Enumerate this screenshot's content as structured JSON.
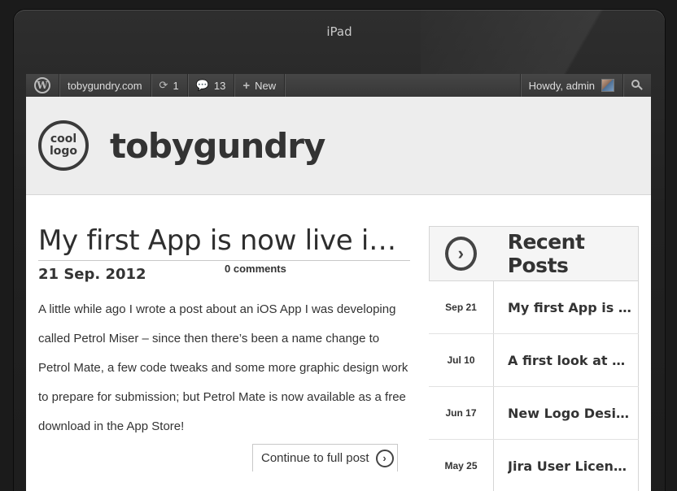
{
  "device": {
    "title": "iPad"
  },
  "adminbar": {
    "wp_logo": "W",
    "site_name": "tobygundry.com",
    "updates_icon": "refresh-icon",
    "updates_count": "1",
    "comments_icon": "comment-bubble-icon",
    "comments_count": "13",
    "new_icon": "plus-icon",
    "new_label": "New",
    "howdy": "Howdy, admin",
    "search_icon": "search-icon"
  },
  "header": {
    "logo_line1": "cool",
    "logo_line2": "logo",
    "site_title": "tobygundry"
  },
  "post": {
    "title": "My first App is now live in t…",
    "date": "21 Sep. 2012",
    "comments": "0 comments",
    "body": "A little while ago I wrote a post about an iOS App I was developing called Petrol Miser – since then there’s been a name change to Petrol Mate, a few code tweaks and some more graphic design work to prepare for submission; but Petrol Mate is now available as a free download in the App Store!",
    "continue_label": "Continue to full post"
  },
  "sidebar": {
    "widget_title": "Recent Posts",
    "recent_posts": [
      {
        "date": "Sep 21",
        "title": "My first App is now…"
      },
      {
        "date": "Jul 10",
        "title": "A first look at RedB…"
      },
      {
        "date": "Jun 17",
        "title": "New Logo Design f…"
      },
      {
        "date": "May 25",
        "title": "Jira User License C…"
      }
    ]
  }
}
